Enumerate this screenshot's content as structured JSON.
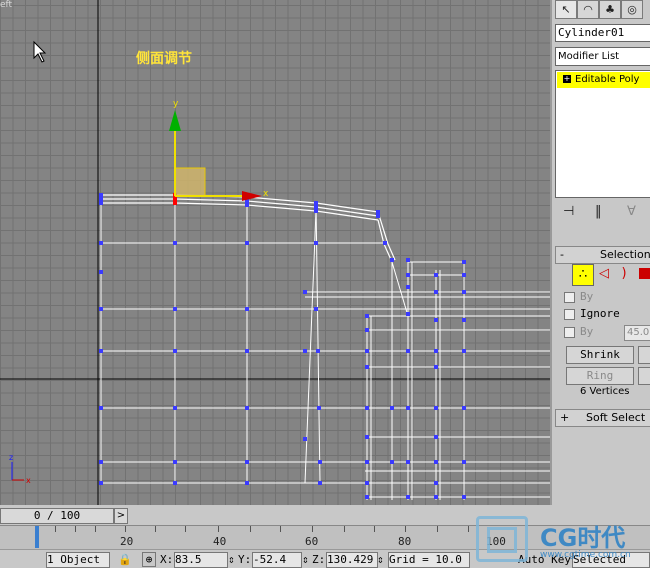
{
  "viewport": {
    "corner_label": "eft",
    "annotation": "侧面调节",
    "gizmo": {
      "y_label": "y",
      "x_label": "x"
    },
    "corner_axis": {
      "z_label": "z",
      "x_label": "x"
    }
  },
  "command_panel": {
    "object_name": "Cylinder01",
    "modifier_list": "Modifier List",
    "stack_item": "Editable Poly",
    "selection_rollout": {
      "sign": "-",
      "title": "Selection",
      "by_vertex_label": "By",
      "ignore_backfacing_label": "Ignore",
      "by_angle_label": "By",
      "angle_value": "45.0",
      "shrink_label": "Shrink",
      "ring_label": "Ring",
      "status": "6 Vertices"
    },
    "soft_selection_rollout": {
      "sign": "+",
      "title": "Soft Select"
    }
  },
  "timeline": {
    "frame_slider": "0 / 100",
    "next_label": ">",
    "ruler_numbers": [
      "20",
      "40",
      "60",
      "80",
      "100"
    ]
  },
  "status_bar": {
    "objects_selected": "1 Object",
    "x_label": "X:",
    "x_value": "83.5",
    "y_label": "Y:",
    "y_value": "-52.4",
    "z_label": "Z:",
    "z_value": "130.429",
    "grid": "Grid = 10.0",
    "autokey": "Auto Key",
    "selected": "Selected"
  },
  "watermark": {
    "brand": "CG时代",
    "url": "www.cgtime.com.cn"
  },
  "colors": {
    "viewport_bg": "#848484",
    "wire": "#ffffff",
    "vertex": "#3a3aff",
    "selected_vertex": "#ff0000",
    "y_axis": "#00b000",
    "x_axis": "#d00000",
    "stack_highlight": "#ffff00",
    "annotation": "#ffe43a"
  }
}
